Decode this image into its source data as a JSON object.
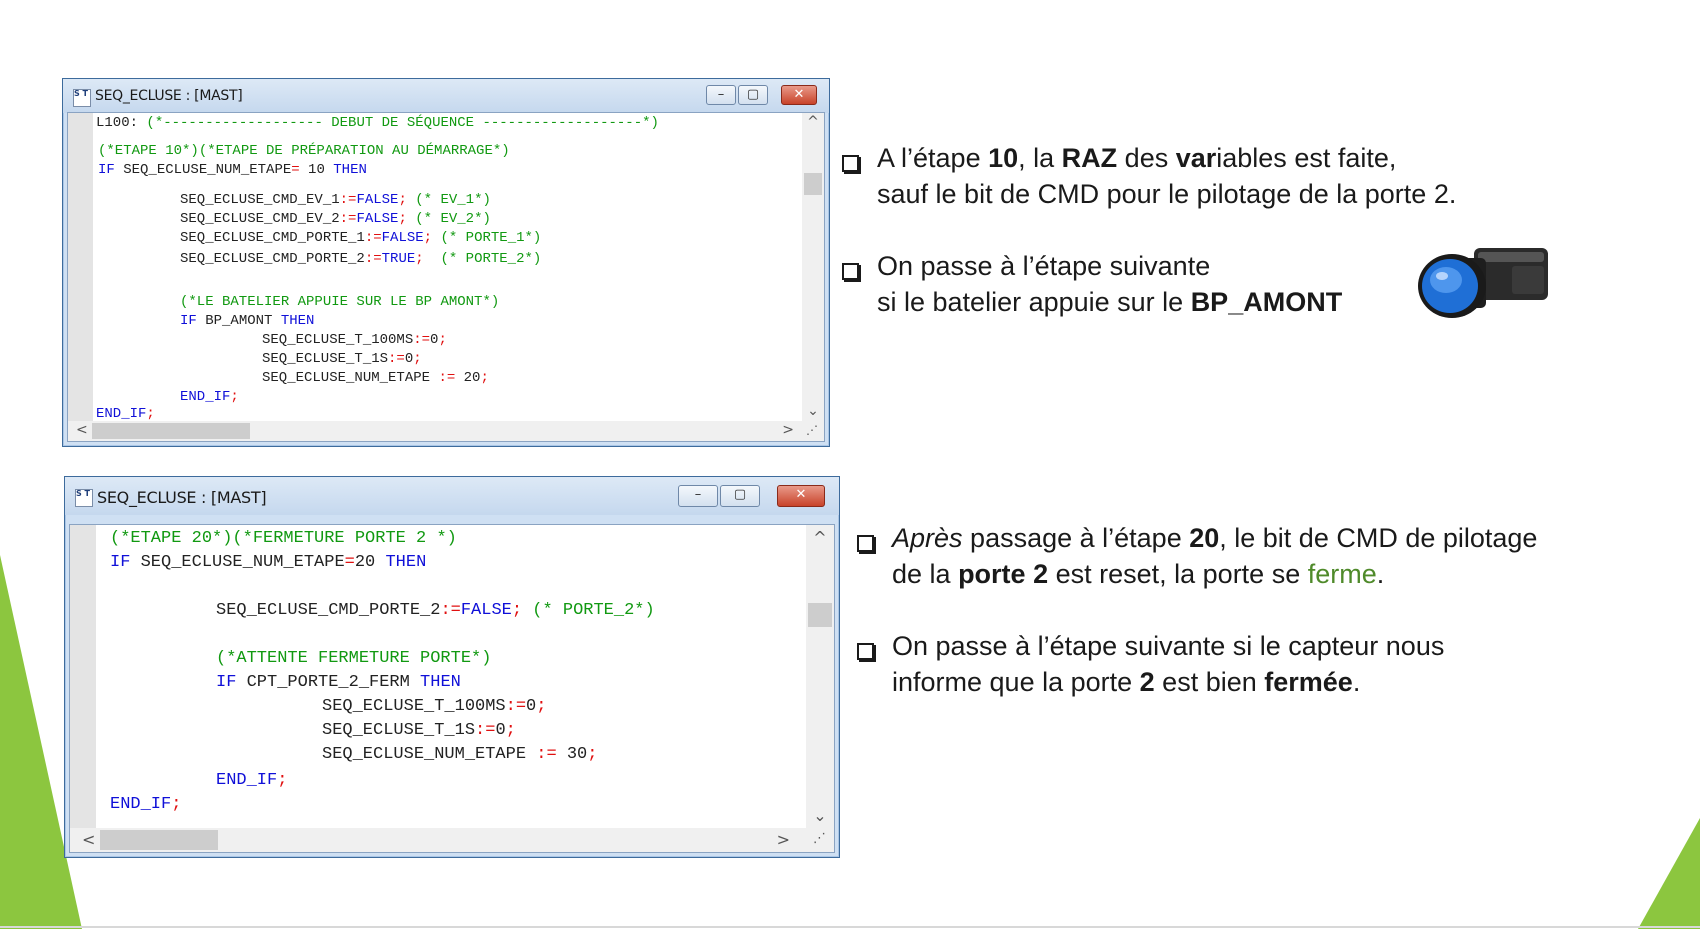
{
  "colors": {
    "accent_green": "#8cc63f",
    "keyword": "#1010d8",
    "comment": "#119911",
    "operator": "#e01010",
    "title_bar": "#c5d8ee"
  },
  "window1": {
    "title": "SEQ_ECLUSE : [MAST]",
    "icon": "st-editor-icon",
    "icon_text": "S T",
    "controls": {
      "minimize": "–",
      "maximize": "▢",
      "close": "✕"
    }
  },
  "window2": {
    "title": "SEQ_ECLUSE : [MAST]",
    "icon": "st-editor-icon",
    "icon_text": "S T",
    "controls": {
      "minimize": "–",
      "maximize": "▢",
      "close": "✕"
    }
  },
  "code1": [
    [
      {
        "t": "L100: "
      },
      {
        "t": "(*------------------- DEBUT DE SÉQUENCE -------------------*)",
        "c": "cm"
      }
    ],
    [
      {
        "t": "(*ETAPE 10*)(*ETAPE DE PRÉPARATION AU DÉMARRAGE*)",
        "c": "cm"
      }
    ],
    [
      {
        "t": "IF",
        "c": "kw"
      },
      {
        "t": " SEQ_ECLUSE_NUM_ETAPE"
      },
      {
        "t": "=",
        "c": "op"
      },
      {
        "t": " 10 "
      },
      {
        "t": "THEN",
        "c": "kw"
      }
    ],
    [
      {
        "t": "SEQ_ECLUSE_CMD_EV_1"
      },
      {
        "t": ":=",
        "c": "op"
      },
      {
        "t": "FALSE",
        "c": "kw"
      },
      {
        "t": ";",
        "c": "op"
      },
      {
        "t": " (* EV_1*)",
        "c": "cm"
      }
    ],
    [
      {
        "t": "SEQ_ECLUSE_CMD_EV_2"
      },
      {
        "t": ":=",
        "c": "op"
      },
      {
        "t": "FALSE",
        "c": "kw"
      },
      {
        "t": ";",
        "c": "op"
      },
      {
        "t": " (* EV_2*)",
        "c": "cm"
      }
    ],
    [
      {
        "t": "SEQ_ECLUSE_CMD_PORTE_1"
      },
      {
        "t": ":=",
        "c": "op"
      },
      {
        "t": "FALSE",
        "c": "kw"
      },
      {
        "t": ";",
        "c": "op"
      },
      {
        "t": " (* PORTE_1*)",
        "c": "cm"
      }
    ],
    [
      {
        "t": "SEQ_ECLUSE_CMD_PORTE_2"
      },
      {
        "t": ":=",
        "c": "op"
      },
      {
        "t": "TRUE",
        "c": "kw"
      },
      {
        "t": ";",
        "c": "op"
      },
      {
        "t": "  (* PORTE_2*)",
        "c": "cm"
      }
    ],
    [
      {
        "t": "(*LE BATELIER APPUIE SUR LE BP AMONT*)",
        "c": "cm"
      }
    ],
    [
      {
        "t": "IF",
        "c": "kw"
      },
      {
        "t": " BP_AMONT "
      },
      {
        "t": "THEN",
        "c": "kw"
      }
    ],
    [
      {
        "t": "SEQ_ECLUSE_T_100MS"
      },
      {
        "t": ":=",
        "c": "op"
      },
      {
        "t": "0"
      },
      {
        "t": ";",
        "c": "op"
      }
    ],
    [
      {
        "t": "SEQ_ECLUSE_T_1S"
      },
      {
        "t": ":=",
        "c": "op"
      },
      {
        "t": "0"
      },
      {
        "t": ";",
        "c": "op"
      }
    ],
    [
      {
        "t": "SEQ_ECLUSE_NUM_ETAPE "
      },
      {
        "t": ":=",
        "c": "op"
      },
      {
        "t": " 20"
      },
      {
        "t": ";",
        "c": "op"
      }
    ],
    [
      {
        "t": "END_IF",
        "c": "kw"
      },
      {
        "t": ";",
        "c": "op"
      }
    ],
    [
      {
        "t": "END_IF",
        "c": "kw"
      },
      {
        "t": ";",
        "c": "op"
      }
    ]
  ],
  "code2": [
    [
      {
        "t": "(*ETAPE 20*)(*FERMETURE PORTE 2 *)",
        "c": "cm"
      }
    ],
    [
      {
        "t": "IF",
        "c": "kw"
      },
      {
        "t": " SEQ_ECLUSE_NUM_ETAPE"
      },
      {
        "t": "=",
        "c": "op"
      },
      {
        "t": "20 "
      },
      {
        "t": "THEN",
        "c": "kw"
      }
    ],
    [
      {
        "t": "SEQ_ECLUSE_CMD_PORTE_2"
      },
      {
        "t": ":=",
        "c": "op"
      },
      {
        "t": "FALSE",
        "c": "kw"
      },
      {
        "t": ";",
        "c": "op"
      },
      {
        "t": " (* PORTE_2*)",
        "c": "cm"
      }
    ],
    [
      {
        "t": "(*ATTENTE FERMETURE PORTE*)",
        "c": "cm"
      }
    ],
    [
      {
        "t": "IF",
        "c": "kw"
      },
      {
        "t": " CPT_PORTE_2_FERM "
      },
      {
        "t": "THEN",
        "c": "kw"
      }
    ],
    [
      {
        "t": "SEQ_ECLUSE_T_100MS"
      },
      {
        "t": ":=",
        "c": "op"
      },
      {
        "t": "0"
      },
      {
        "t": ";",
        "c": "op"
      }
    ],
    [
      {
        "t": "SEQ_ECLUSE_T_1S"
      },
      {
        "t": ":=",
        "c": "op"
      },
      {
        "t": "0"
      },
      {
        "t": ";",
        "c": "op"
      }
    ],
    [
      {
        "t": "SEQ_ECLUSE_NUM_ETAPE "
      },
      {
        "t": ":=",
        "c": "op"
      },
      {
        "t": " 30"
      },
      {
        "t": ";",
        "c": "op"
      }
    ],
    [
      {
        "t": "END_IF",
        "c": "kw"
      },
      {
        "t": ";",
        "c": "op"
      }
    ],
    [
      {
        "t": "END_IF",
        "c": "kw"
      },
      {
        "t": ";",
        "c": "op"
      }
    ]
  ],
  "bullets": [
    {
      "lines": [
        [
          {
            "t": "A l’étape "
          },
          {
            "t": "10",
            "b": 1
          },
          {
            "t": ", la "
          },
          {
            "t": "RAZ",
            "b": 1
          },
          {
            "t": " des "
          },
          {
            "t": "var",
            "b": 1
          },
          {
            "t": "iables  est faite,"
          }
        ],
        [
          {
            "t": "sauf le bit de CMD pour le pilotage de la porte 2."
          }
        ]
      ]
    },
    {
      "lines": [
        [
          {
            "t": "On passe à l’étape suivante"
          }
        ],
        [
          {
            "t": "si le batelier appuie sur le "
          },
          {
            "t": "BP_AMONT",
            "b": 1
          }
        ]
      ]
    },
    {
      "lines": [
        [
          {
            "t": "Après",
            "i": 1
          },
          {
            "t": " passage à l’étape "
          },
          {
            "t": "20",
            "b": 1
          },
          {
            "t": ", le bit de CMD de pilotage"
          }
        ],
        [
          {
            "t": "de la "
          },
          {
            "t": "porte 2",
            "b": 1
          },
          {
            "t": " est reset, la porte se "
          },
          {
            "t": "ferme",
            "g": 1
          },
          {
            "t": "."
          }
        ]
      ]
    },
    {
      "lines": [
        [
          {
            "t": "On passe à l’étape suivante si le capteur nous"
          }
        ],
        [
          {
            "t": "informe que la porte "
          },
          {
            "t": "2",
            "b": 1
          },
          {
            "t": " est bien "
          },
          {
            "t": "fermée",
            "b": 1
          },
          {
            "t": "."
          }
        ]
      ]
    }
  ],
  "push_button_icon": "blue-push-button-icon",
  "scroll_arrows": {
    "up": "^",
    "down": "⌄",
    "left": "<",
    "right": ">",
    "grip": "⋰"
  }
}
